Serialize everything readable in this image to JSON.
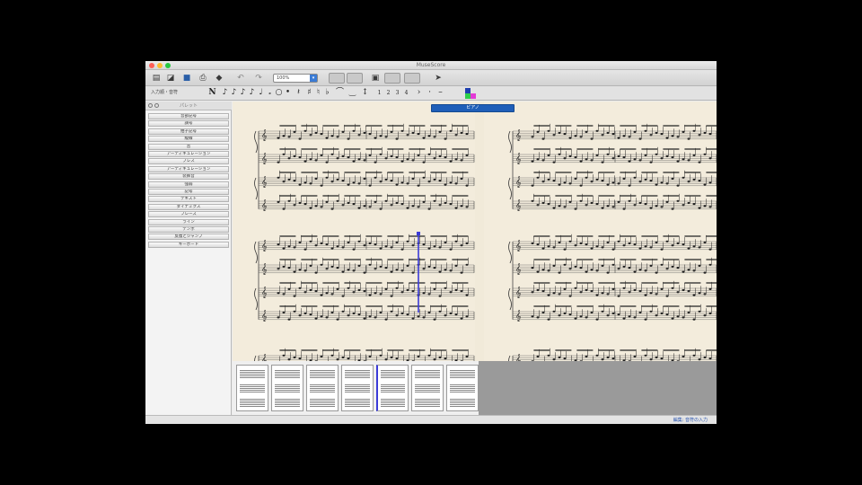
{
  "window": {
    "title": "MuseScore",
    "traffic_colors": [
      "#ff5f57",
      "#febc2e",
      "#28c840"
    ]
  },
  "toolbar": {
    "zoom_value": "100%",
    "voice_label": "入力順・音符"
  },
  "palette": {
    "header": "パレット",
    "items": [
      "音部記号",
      "調号",
      "拍子記号",
      "縦線",
      "音",
      "アーティキュレーション",
      "ブレス",
      "アーティキュレーション",
      "装飾音",
      "強弱",
      "記号",
      "テキスト",
      "ダイナミクス",
      "フレーズ",
      "ライン",
      "テンポ",
      "反復とジャンプ",
      "キーボード"
    ]
  },
  "score": {
    "instrument_label": "ピアノ"
  },
  "status": {
    "text": "編集: 音符の入力"
  },
  "colors": {
    "score_bg": "#f1ead9",
    "accent": "#1f5fb8",
    "cursor": "#3b3bd8"
  }
}
